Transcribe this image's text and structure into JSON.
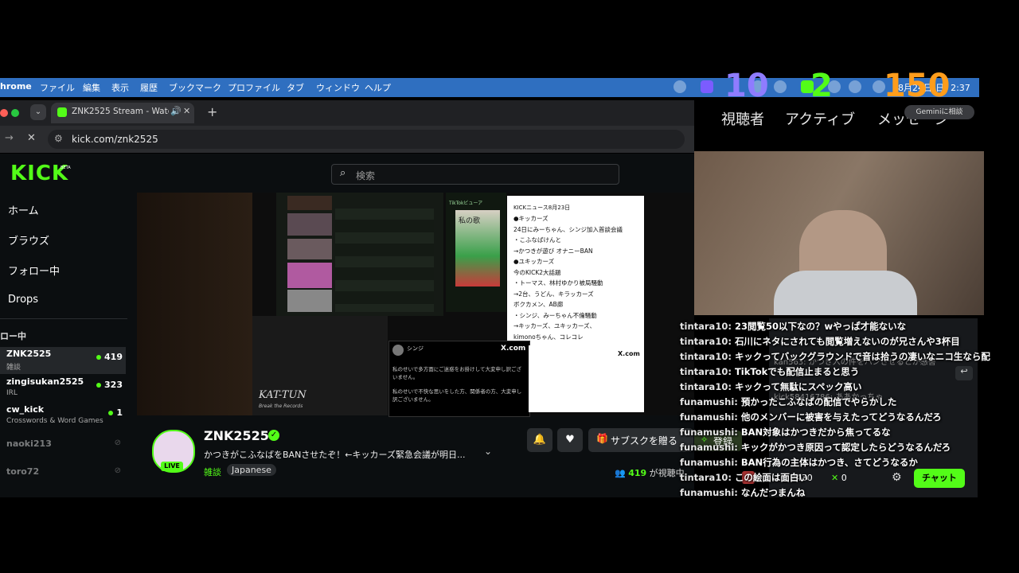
{
  "menubar": {
    "app": "hrome",
    "items": [
      "ファイル",
      "編集",
      "表示",
      "履歴",
      "ブックマーク",
      "プロファイル",
      "タブ",
      "ウィンドウ",
      "ヘルプ"
    ],
    "clock": "8月24日(日) 2:37"
  },
  "overlay": {
    "viewers": {
      "value": "10",
      "label": "視聴者",
      "color": "#8f7cff"
    },
    "active": {
      "value": "2",
      "label": "アクティブ",
      "color": "#53fc18"
    },
    "messages": {
      "value": "150",
      "label": "メッセージ",
      "color": "#ff9d1c"
    },
    "gemini": "Geminiに相談"
  },
  "browser": {
    "tab_title": "ZNK2525 Stream - Watch",
    "url": "kick.com/znk2525"
  },
  "kick": {
    "logo": "KICK",
    "logo_beta": "BETA",
    "search_placeholder": "検索",
    "nav": [
      "ホーム",
      "ブラウズ",
      "フォロー中",
      "Drops"
    ],
    "following_header": "ロー中",
    "channels": [
      {
        "name": "ZNK2525",
        "category": "雑談",
        "viewers": "419"
      },
      {
        "name": "zingisukan2525",
        "category": "IRL",
        "viewers": "323"
      },
      {
        "name": "cw_kick",
        "category": "Crosswords & Word Games",
        "viewers": "1"
      },
      {
        "name": "naoki213",
        "category": "",
        "viewers": ""
      },
      {
        "name": "toro72",
        "category": "",
        "viewers": ""
      }
    ],
    "streamer": {
      "name": "ZNK2525",
      "title": "かつきがこふなばをBANさせたぞ！←キッカーズ緊急会議が明日...",
      "category": "雑談",
      "language": "Japanese",
      "live": "LIVE",
      "viewers": "419",
      "viewers_suffix": "が視聴中"
    },
    "subscribe": "サブスクを贈る",
    "register": "登録",
    "chat_button": "チャット",
    "stat_points": "2430",
    "stat_zero": "0"
  },
  "video": {
    "news_title": "KICKニュース8月23日",
    "news_lines": [
      "●キッカーズ",
      "24日にみーちゃん、シンジ加入首談会議",
      "・こふなばけんと",
      "→かつきが遊び オナニーBAN",
      "●ユキッカーズ",
      "今のKICK2大話題",
      "・トーマス、林村ゆかり被局騒動",
      "→2台、うどん、キラッカーズ",
      "ボクカメン、AB廊",
      "・シンジ、みーちゃん不倫騒動",
      "→キッカーズ、ユキッカーズ、",
      "kimonoちゃん、コレコレ"
    ],
    "poster_title": "KAT-TUN",
    "poster_sub": "Break the Records",
    "tweet_user": "シンジ",
    "tweet_body": "私のせいで多方面にご迷惑をお掛けして大変申し訳ございません。",
    "tweet_body2": "私のせいで不快な思いをした方、関係者の方、大変申し訳ございません。",
    "x_label": "X.com",
    "tiktok_label": "TikTokビューア",
    "song_label": "私の歌"
  },
  "chat": [
    {
      "user": "tintara10",
      "msg": "23閲覧50以下なの？wやっぱ才能ないな"
    },
    {
      "user": "tintara10",
      "msg": "石川にネタにされても閲覧増えないのが兄さんや3杯目"
    },
    {
      "user": "tintara10",
      "msg": "キックってバックグラウンドで音は拾うの凄いなニコ生なら配"
    },
    {
      "user": "tintara10",
      "msg": "TikTokでも配信止まると思う"
    },
    {
      "user": "tintara10",
      "msg": "キックって無駄にスペック高い"
    },
    {
      "user": "funamushi",
      "msg": "預かったこふなばの配信でやらかした"
    },
    {
      "user": "funamushi",
      "msg": "他のメンバーに被害を与えたってどうなるんだろ"
    },
    {
      "user": "funamushi",
      "msg": "BAN対象はかつきだから焦ってるな"
    },
    {
      "user": "funamushi",
      "msg": "キックがかつき原因って認定したらどうなるんだろ"
    },
    {
      "user": "funamushi",
      "msg": "BAN行為の主体はかつき、さてどうなるか"
    },
    {
      "user": "tintara10",
      "msg": "この絵面は面白い"
    },
    {
      "user": "funamushi",
      "msg": "なんだつまんね"
    }
  ],
  "ghost_chat": [
    {
      "user": "kan563",
      "msg": "かつき入の件をハンさせるとか感害"
    },
    {
      "user": "kick58416786",
      "msg": "ああかっちゃ"
    }
  ]
}
